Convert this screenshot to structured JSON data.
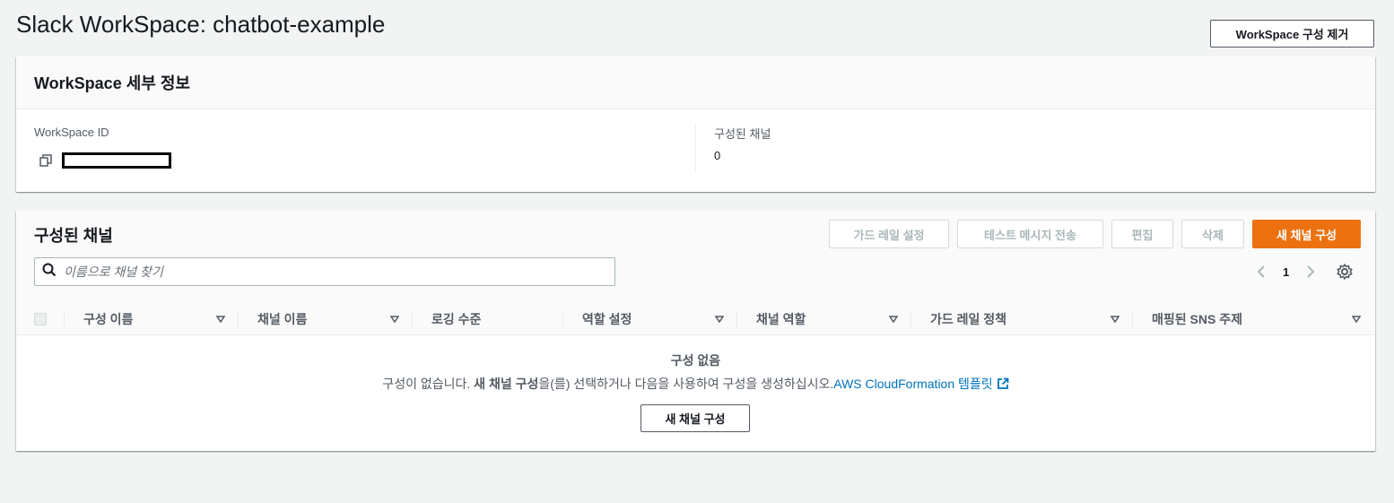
{
  "page": {
    "title": "Slack WorkSpace: chatbot-example",
    "remove_button": "WorkSpace 구성 제거"
  },
  "details": {
    "header": "WorkSpace 세부 정보",
    "workspace_id_label": "WorkSpace ID",
    "configured_channels_label": "구성된 채널",
    "configured_channels_value": "0"
  },
  "channels": {
    "title": "구성된 채널",
    "actions": {
      "guardrail": "가드 레일 설정",
      "test_message": "테스트 메시지 전송",
      "edit": "편집",
      "delete": "삭제",
      "new_channel": "새 채널 구성"
    },
    "search_placeholder": "이름으로 채널 찾기",
    "page_number": "1",
    "columns": [
      "구성 이름",
      "채널 이름",
      "로깅 수준",
      "역할 설정",
      "채널 역할",
      "가드 레일 정책",
      "매핑된 SNS 주제"
    ],
    "empty": {
      "title": "구성 없음",
      "desc_prefix": "구성이 없습니다. ",
      "desc_bold": "새 채널 구성",
      "desc_middle": "을(를) 선택하거나 다음을 사용하여 구성을 생성하십시오.",
      "desc_link": "AWS CloudFormation 템플릿",
      "button": "새 채널 구성"
    }
  },
  "colors": {
    "primary": "#ec7211",
    "link": "#0073bb",
    "background": "#f2f3f3"
  },
  "icons": [
    "copy-icon",
    "search-icon",
    "chevron-left-icon",
    "chevron-right-icon",
    "gear-icon",
    "sort-caret-icon",
    "external-link-icon"
  ]
}
